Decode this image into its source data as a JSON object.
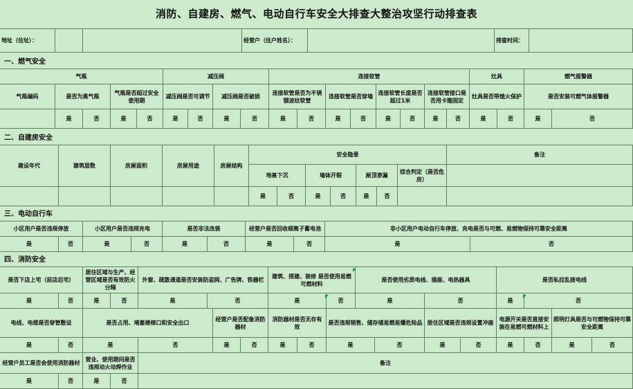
{
  "title": "消防、自建房、燃气、电动自行车安全大排查大整治攻坚行动排查表",
  "header": {
    "address": "地址（住址）：",
    "manager": "经营户（住户姓名）：",
    "check_time": "排查时间："
  },
  "opt": {
    "yes": "是",
    "no": "否"
  },
  "s1": {
    "title": "一、燃气安全",
    "groups": {
      "cylinder": "气瓶",
      "regulator": "减压阀",
      "hose": "连接软管",
      "stove": "灶具",
      "alarm": "燃气报警器"
    },
    "cols": {
      "cyl_no": "气瓶编码",
      "cyl_black": "是否为黑气瓶",
      "cyl_expired": "气瓶是否超过安全使用期",
      "reg_adjust": "减压阀是否可调节",
      "reg_damaged": "减压阀是否破损",
      "hose_steel": "连接软管是否为不锈钢波纹软管",
      "hose_through": "连接软管是否穿墙",
      "hose_length": "连接软管长度是否超过1米",
      "hose_clamp": "连接软管接口是否用卡箍固定",
      "stove_flame": "灶具是否带熄火保护",
      "alarm_installed": "是否安装可燃气体报警器"
    }
  },
  "s2": {
    "title": "二、自建房安全",
    "cols": {
      "year": "建设年代",
      "floors": "建筑层数",
      "area": "房屋面积",
      "use": "房屋用途",
      "structure": "房屋结构",
      "hazard": "安全隐患",
      "remark": "备注"
    },
    "sub": {
      "sink": "地基下沉",
      "crack": "墙体开裂",
      "roof": "屋顶渗漏",
      "overall": "综合判定（是否危房）"
    }
  },
  "s3": {
    "title": "三、电动自行车",
    "cols": {
      "parking": "小区用户是否违规停放",
      "charging": "小区用户是否违规充电",
      "modified": "是否非法改装",
      "battery": "经营户是否回收细离子蓄电池",
      "nonres": "非小区用户电动自行车停放、充电是否与可燃、易燃物保持可靠安全距离"
    }
  },
  "s4": {
    "title": "四、消防安全",
    "row1": {
      "shop_living": "是否下店上宅（前店后宅）",
      "separation": "居住区域与生产、经营区域是否有效防火分隔",
      "windows": "外窗、疏散通道是否安装防盗网、广告牌、铁栅栏",
      "material": "建筑、搭建、装修 是否使用易燃可燃材料",
      "wires": "是否使用劣质电线、插座、电热器具",
      "private_wire": "是否私拉乱接电线"
    },
    "row2": {
      "protect": "电线、电缆是否穿管敷设",
      "exit": "是否占用、堵塞楼梯口和安全出口",
      "equip": "经营户是否配备消防器材",
      "valid": "消防器材是否无存有效",
      "flammable": "是否违规销售、储存储易燃易爆危险品",
      "living_area": "居住区域是否违规设置冲座",
      "switch": "电源开关是否直接安装在易燃可燃材料上",
      "lamp": "照明灯具是否与可燃物保持可靠安全距离"
    },
    "row3": {
      "staff": "经营户员工是否会使用消防器材",
      "fire_use": "营业、使用期间是否违规动火动焊作业",
      "remark": "备注"
    }
  }
}
